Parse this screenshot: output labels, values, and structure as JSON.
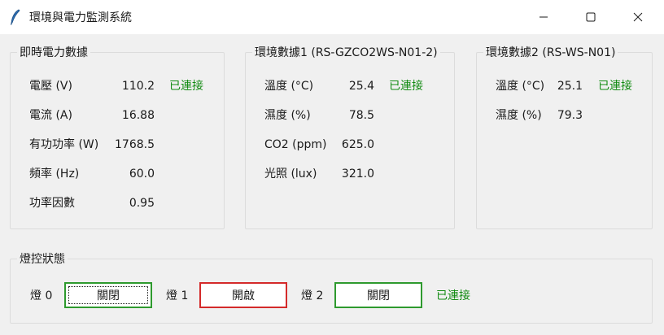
{
  "window": {
    "title": "環境與電力監測系統",
    "icon": "feather-icon",
    "controls": [
      "minimize-icon",
      "maximize-icon",
      "close-icon"
    ]
  },
  "power": {
    "title": "即時電力數據",
    "status": "已連接",
    "rows": [
      {
        "label": "電壓 (V)",
        "value": "110.2"
      },
      {
        "label": "電流 (A)",
        "value": "16.88"
      },
      {
        "label": "有功功率 (W)",
        "value": "1768.5"
      },
      {
        "label": "頻率 (Hz)",
        "value": "60.0"
      },
      {
        "label": "功率因數",
        "value": "0.95"
      }
    ]
  },
  "env1": {
    "title": "環境數據1 (RS-GZCO2WS-N01-2)",
    "status": "已連接",
    "rows": [
      {
        "label": "溫度 (°C)",
        "value": "25.4"
      },
      {
        "label": "濕度 (%)",
        "value": "78.5"
      },
      {
        "label": "CO2 (ppm)",
        "value": "625.0"
      },
      {
        "label": "光照 (lux)",
        "value": "321.0"
      }
    ]
  },
  "env2": {
    "title": "環境數據2 (RS-WS-N01)",
    "status": "已連接",
    "rows": [
      {
        "label": "溫度 (°C)",
        "value": "25.1"
      },
      {
        "label": "濕度 (%)",
        "value": "79.3"
      }
    ]
  },
  "lamps": {
    "title": "燈控狀態",
    "status": "已連接",
    "items": [
      {
        "label": "燈 0",
        "button": "關閉",
        "state": "off",
        "color": "#2e9a2e"
      },
      {
        "label": "燈 1",
        "button": "開啟",
        "state": "on",
        "color": "#d42a2a"
      },
      {
        "label": "燈 2",
        "button": "關閉",
        "state": "off",
        "color": "#2e9a2e"
      }
    ]
  },
  "colors": {
    "connected": "#108a10",
    "lamp_on_border": "#d42a2a",
    "lamp_off_border": "#2e9a2e"
  }
}
